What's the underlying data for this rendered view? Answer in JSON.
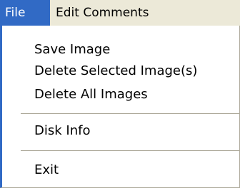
{
  "menubar": {
    "items": [
      {
        "label": "File",
        "active": true
      },
      {
        "label": "Edit Comments",
        "active": false
      }
    ]
  },
  "file_menu": {
    "items": [
      {
        "label": "Save Image"
      },
      {
        "label": "Delete Selected Image(s)"
      },
      {
        "label": "Delete All Images"
      },
      {
        "label": "Disk Info"
      },
      {
        "label": "Exit"
      }
    ]
  },
  "colors": {
    "highlight": "#316ac5",
    "menubar_bg": "#ece9d8",
    "separator": "#aca899"
  }
}
